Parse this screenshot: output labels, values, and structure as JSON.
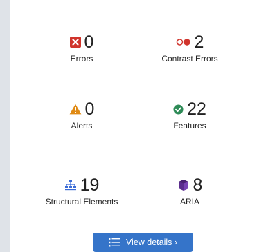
{
  "summary": {
    "errors": {
      "count": "0",
      "label": "Errors",
      "icon": "error-x-icon",
      "color": "#d0342c"
    },
    "contrast_errors": {
      "count": "2",
      "label": "Contrast Errors",
      "icon": "contrast-icon",
      "color": "#d0342c"
    },
    "alerts": {
      "count": "0",
      "label": "Alerts",
      "icon": "warning-triangle-icon",
      "color": "#e08a13"
    },
    "features": {
      "count": "22",
      "label": "Features",
      "icon": "check-circle-icon",
      "color": "#2e8b57"
    },
    "structural": {
      "count": "19",
      "label": "Structural Elements",
      "icon": "sitemap-icon",
      "color": "#3a6bd6"
    },
    "aria": {
      "count": "8",
      "label": "ARIA",
      "icon": "cube-icon",
      "color": "#5b2d8e"
    }
  },
  "details_button": {
    "label": "View details ›",
    "icon": "list-icon",
    "color": "#3574c9"
  }
}
